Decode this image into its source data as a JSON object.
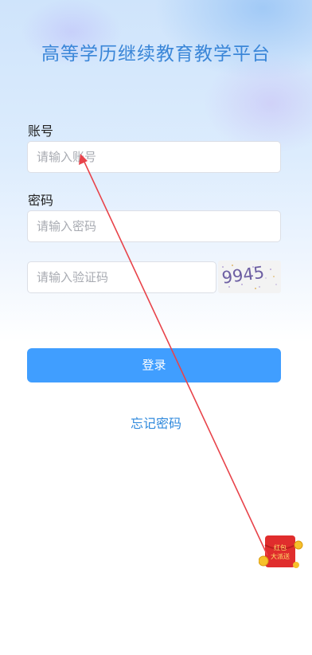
{
  "title": "高等学历继续教育教学平台",
  "account": {
    "label": "账号",
    "placeholder": "请输入账号"
  },
  "password": {
    "label": "密码",
    "placeholder": "请输入密码"
  },
  "verify": {
    "placeholder": "请输入验证码",
    "captcha_text": "9945"
  },
  "login_button": "登录",
  "forgot_password": "忘记密码",
  "red_packet": {
    "line1": "红包",
    "line2": "大派送"
  },
  "colors": {
    "primary": "#409eff",
    "title": "#3a86d8",
    "annotation": "#e8434a"
  }
}
